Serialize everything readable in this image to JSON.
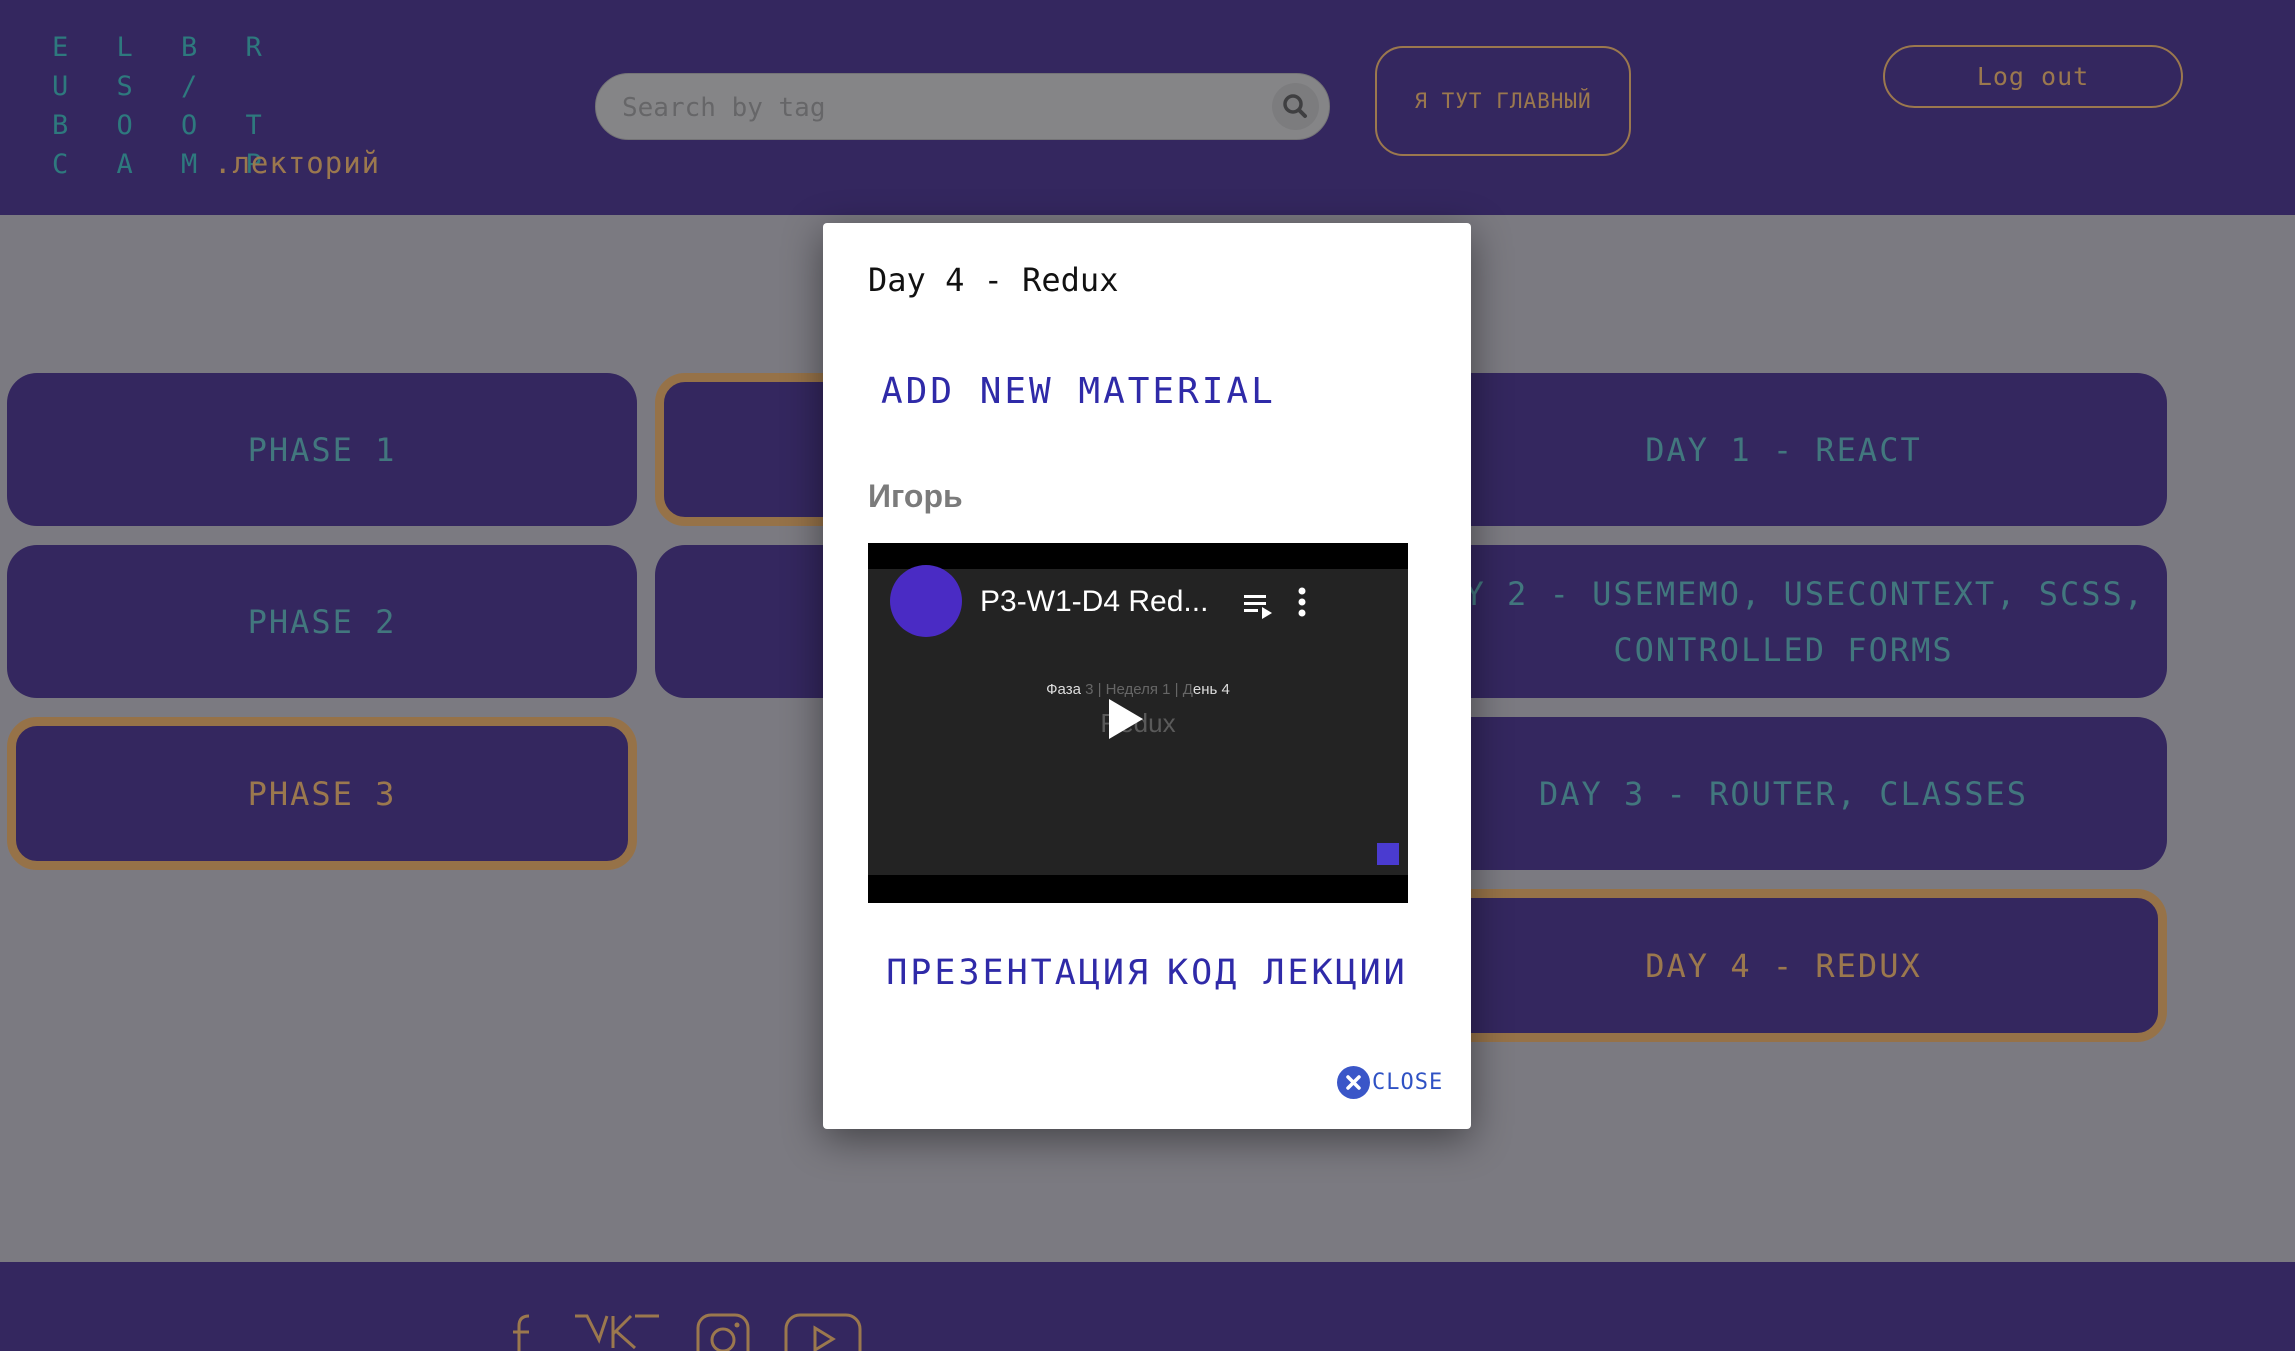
{
  "header": {
    "logo_lines": [
      "E L B R",
      "U S /",
      "B O O T",
      "C A M P"
    ],
    "logo_sub": ".лекторий",
    "search_placeholder": "Search by tag",
    "main_button": "Я ТУТ ГЛАВНЫЙ",
    "logout_button": "Log out"
  },
  "phases": [
    "PHASE 1",
    "PHASE 2",
    "PHASE 3"
  ],
  "days": [
    "DAY 1 - REACT",
    "DAY 2 - USEMEMO, USECONTEXT, SCSS, CONTROLLED FORMS",
    "DAY 3 - ROUTER, CLASSES",
    "DAY 4 - REDUX"
  ],
  "modal": {
    "title": "Day 4 - Redux",
    "add_material": "ADD NEW MATERIAL",
    "author": "Игорь",
    "video": {
      "title": "P3-W1-D4 Red...",
      "subtitle_a": "Фаза",
      "subtitle_b": "3 | Неделя 1 | Д",
      "subtitle_c": "ень 4",
      "bigtext": "Redux"
    },
    "links": [
      "ПРЕЗЕНТАЦИЯ",
      "КОД ЛЕКЦИИ"
    ],
    "close": "CLOSE"
  },
  "footer": {
    "social_icons": [
      "facebook-icon",
      "vk-icon",
      "instagram-icon",
      "youtube-icon"
    ]
  },
  "colors": {
    "brand": "#250d6f",
    "accent": "#e0a050",
    "teal": "#3f9fa8",
    "link": "#2f2aa8"
  }
}
